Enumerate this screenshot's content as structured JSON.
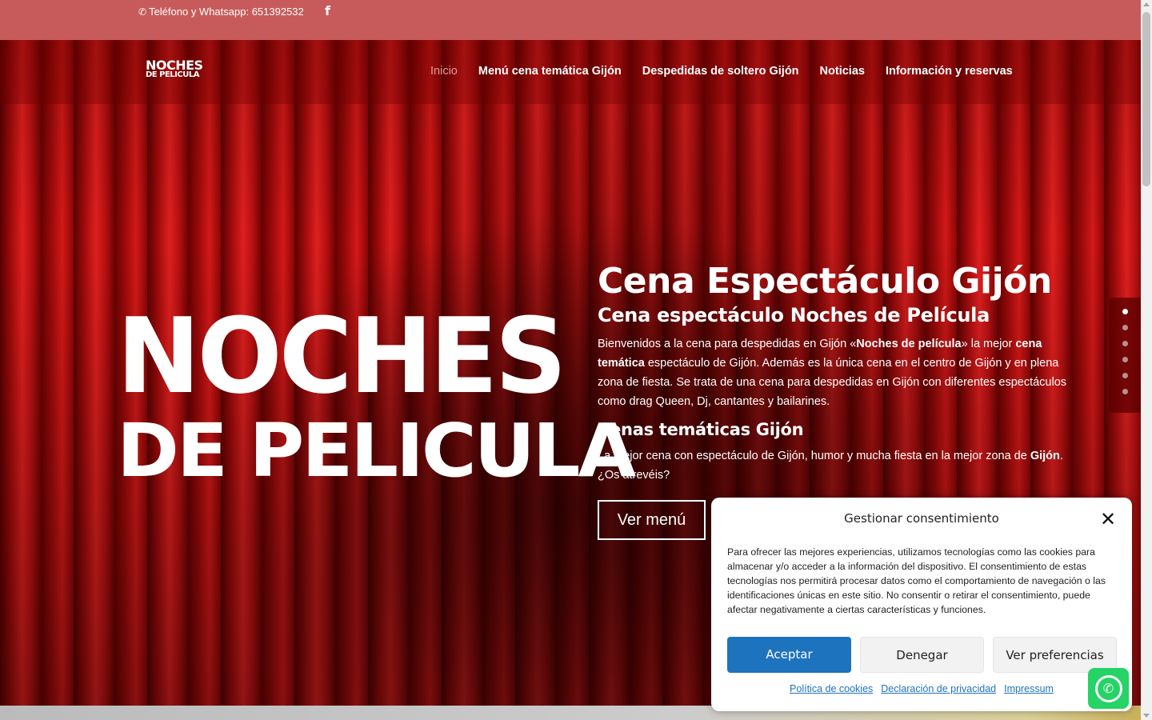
{
  "topbar": {
    "phone_text": "Teléfono y Whatsapp: 651392532",
    "phone_icon": "phone-icon",
    "facebook_icon": "facebook-icon"
  },
  "header": {
    "logo_line1": "NOCHES",
    "logo_line2": "DE PELICULA",
    "nav": [
      {
        "label": "Inicio",
        "active": true
      },
      {
        "label": "Menú cena temática Gijón",
        "active": false
      },
      {
        "label": "Despedidas de soltero Gijón",
        "active": false
      },
      {
        "label": "Noticias",
        "active": false
      },
      {
        "label": "Información y reservas",
        "active": false
      }
    ]
  },
  "hero": {
    "logo_line1": "NOCHES",
    "logo_line2": "DE PELICULA",
    "title": "Cena Espectáculo Gijón",
    "subtitle": "Cena espectáculo Noches de Película",
    "para1_a": "Bienvenidos a la cena para despedidas en Gijón «",
    "para1_b": "Noches de película",
    "para1_c": "» la mejor ",
    "para1_d": "cena temática",
    "para1_e": " espectáculo de Gijón. Además es la única cena en el centro de Gijón y en plena zona de fiesta. Se trata de una cena para despedidas en Gijón con diferentes espectáculos como drag Queen, Dj, cantantes y bailarines.",
    "heading2": "Cenas temáticas Gijón",
    "para2_a": "La mejor cena con espectáculo de Gijón, humor y mucha fiesta en la mejor zona de ",
    "para2_b": "Gijón",
    "para2_c": ". ¿Os atrevéis?",
    "button_label": "Ver menú",
    "slides_count": 6,
    "active_slide": 0
  },
  "consent": {
    "title": "Gestionar consentimiento",
    "close_icon": "close-icon",
    "body": "Para ofrecer las mejores experiencias, utilizamos tecnologías como las cookies para almacenar y/o acceder a la información del dispositivo. El consentimiento de estas tecnologías nos permitirá procesar datos como el comportamiento de navegación o las identificaciones únicas en este sitio. No consentir o retirar el consentimiento, puede afectar negativamente a ciertas características y funciones.",
    "accept_label": "Aceptar",
    "deny_label": "Denegar",
    "prefs_label": "Ver preferencias",
    "links": [
      "Política de cookies",
      "Declaración de privacidad",
      "Impressum"
    ]
  },
  "colors": {
    "topbar": "#c75b5b",
    "accent_blue": "#1e73be",
    "whatsapp_green": "#25d366",
    "nav_active": "#e59c9c"
  },
  "whatsapp_icon": "whatsapp-icon"
}
